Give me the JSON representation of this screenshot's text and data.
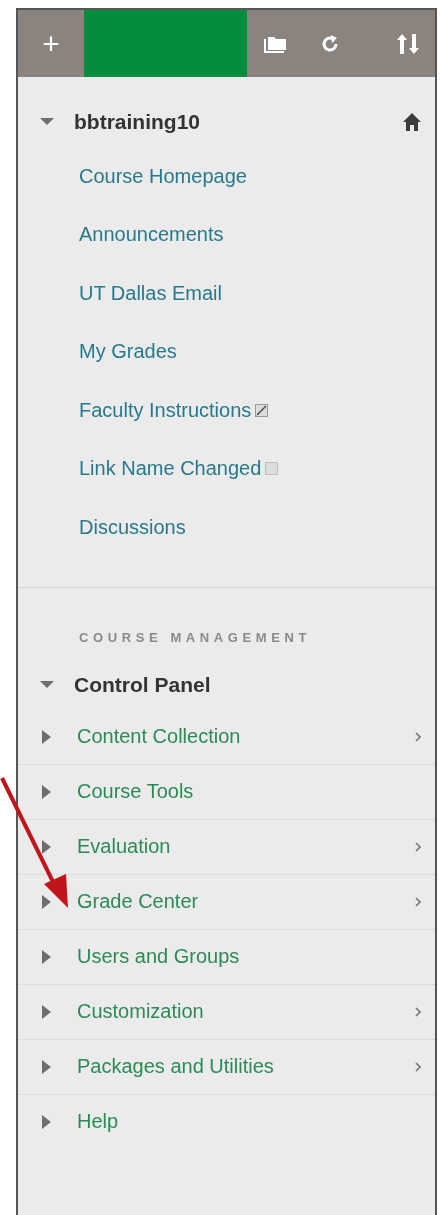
{
  "toolbar": {
    "buttons": [
      {
        "kind": "add",
        "label": "+"
      },
      {
        "kind": "banner"
      },
      {
        "kind": "folder"
      },
      {
        "kind": "refresh"
      },
      {
        "kind": "sort"
      }
    ]
  },
  "course": {
    "title": "bbtraining10",
    "expanded": true,
    "links": [
      {
        "label": "Course Homepage",
        "unavailable": false,
        "empty": false
      },
      {
        "label": "Announcements",
        "unavailable": false,
        "empty": false
      },
      {
        "label": "UT Dallas Email",
        "unavailable": false,
        "empty": false
      },
      {
        "label": "My Grades",
        "unavailable": false,
        "empty": false
      },
      {
        "label": "Faculty Instructions",
        "unavailable": true,
        "empty": false
      },
      {
        "label": "Link Name Changed",
        "unavailable": false,
        "empty": true
      },
      {
        "label": "Discussions",
        "unavailable": false,
        "empty": false
      }
    ]
  },
  "management": {
    "heading": "COURSE MANAGEMENT",
    "title": "Control Panel",
    "expanded": true,
    "items": [
      {
        "label": "Content Collection",
        "expanded": false,
        "has_submenu": true
      },
      {
        "label": "Course Tools",
        "expanded": false,
        "has_submenu": false
      },
      {
        "label": "Evaluation",
        "expanded": false,
        "has_submenu": true
      },
      {
        "label": "Grade Center",
        "expanded": false,
        "has_submenu": true
      },
      {
        "label": "Users and Groups",
        "expanded": false,
        "has_submenu": false
      },
      {
        "label": "Customization",
        "expanded": false,
        "has_submenu": true
      },
      {
        "label": "Packages and Utilities",
        "expanded": false,
        "has_submenu": true
      },
      {
        "label": "Help",
        "expanded": false,
        "has_submenu": false
      }
    ]
  }
}
